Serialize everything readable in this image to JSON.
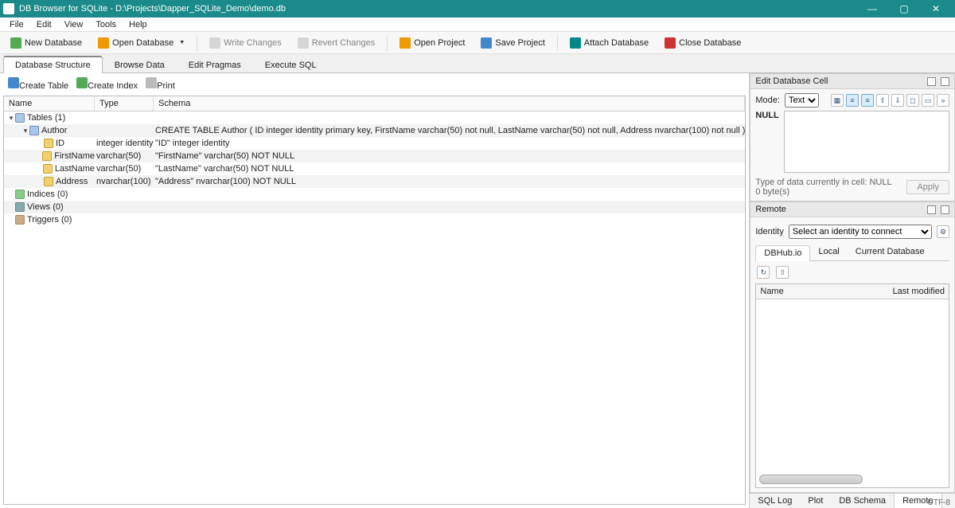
{
  "window": {
    "title": "DB Browser for SQLite - D:\\Projects\\Dapper_SQLite_Demo\\demo.db"
  },
  "menubar": [
    "File",
    "Edit",
    "View",
    "Tools",
    "Help"
  ],
  "toolbar": {
    "new_db": "New Database",
    "open_db": "Open Database",
    "write_changes": "Write Changes",
    "revert_changes": "Revert Changes",
    "open_project": "Open Project",
    "save_project": "Save Project",
    "attach_db": "Attach Database",
    "close_db": "Close Database"
  },
  "tabs": {
    "items": [
      "Database Structure",
      "Browse Data",
      "Edit Pragmas",
      "Execute SQL"
    ],
    "active": 0
  },
  "subtoolbar": {
    "create_table": "Create Table",
    "create_index": "Create Index",
    "print": "Print"
  },
  "tree": {
    "headers": {
      "name": "Name",
      "type": "Type",
      "schema": "Schema"
    },
    "rows": [
      {
        "depth": 0,
        "expand": "▾",
        "icon": "tbl",
        "name": "Tables (1)",
        "type": "",
        "schema": ""
      },
      {
        "depth": 1,
        "expand": "▾",
        "icon": "tbl",
        "name": "Author",
        "type": "",
        "schema": "CREATE TABLE Author ( ID integer identity primary key, FirstName varchar(50) not null, LastName varchar(50) not null, Address nvarchar(100) not null )"
      },
      {
        "depth": 2,
        "expand": "",
        "icon": "key",
        "name": "ID",
        "type": "integer identity",
        "schema": "\"ID\" integer identity"
      },
      {
        "depth": 2,
        "expand": "",
        "icon": "fld",
        "name": "FirstName",
        "type": "varchar(50)",
        "schema": "\"FirstName\" varchar(50) NOT NULL"
      },
      {
        "depth": 2,
        "expand": "",
        "icon": "fld",
        "name": "LastName",
        "type": "varchar(50)",
        "schema": "\"LastName\" varchar(50) NOT NULL"
      },
      {
        "depth": 2,
        "expand": "",
        "icon": "fld",
        "name": "Address",
        "type": "nvarchar(100)",
        "schema": "\"Address\" nvarchar(100) NOT NULL"
      },
      {
        "depth": 0,
        "expand": "",
        "icon": "idx",
        "name": "Indices (0)",
        "type": "",
        "schema": ""
      },
      {
        "depth": 0,
        "expand": "",
        "icon": "vw",
        "name": "Views (0)",
        "type": "",
        "schema": ""
      },
      {
        "depth": 0,
        "expand": "",
        "icon": "trg",
        "name": "Triggers (0)",
        "type": "",
        "schema": ""
      }
    ]
  },
  "editcell": {
    "title": "Edit Database Cell",
    "mode_label": "Mode:",
    "mode_value": "Text",
    "null_label": "NULL",
    "type_text": "Type of data currently in cell: NULL",
    "size_text": "0 byte(s)",
    "apply": "Apply"
  },
  "remote": {
    "title": "Remote",
    "identity_label": "Identity",
    "identity_placeholder": "Select an identity to connect",
    "tabs": [
      "DBHub.io",
      "Local",
      "Current Database"
    ],
    "list_headers": {
      "name": "Name",
      "last_modified": "Last modified"
    }
  },
  "status_tabs": [
    "SQL Log",
    "Plot",
    "DB Schema",
    "Remote"
  ],
  "statusbar": {
    "encoding": "UTF-8"
  }
}
